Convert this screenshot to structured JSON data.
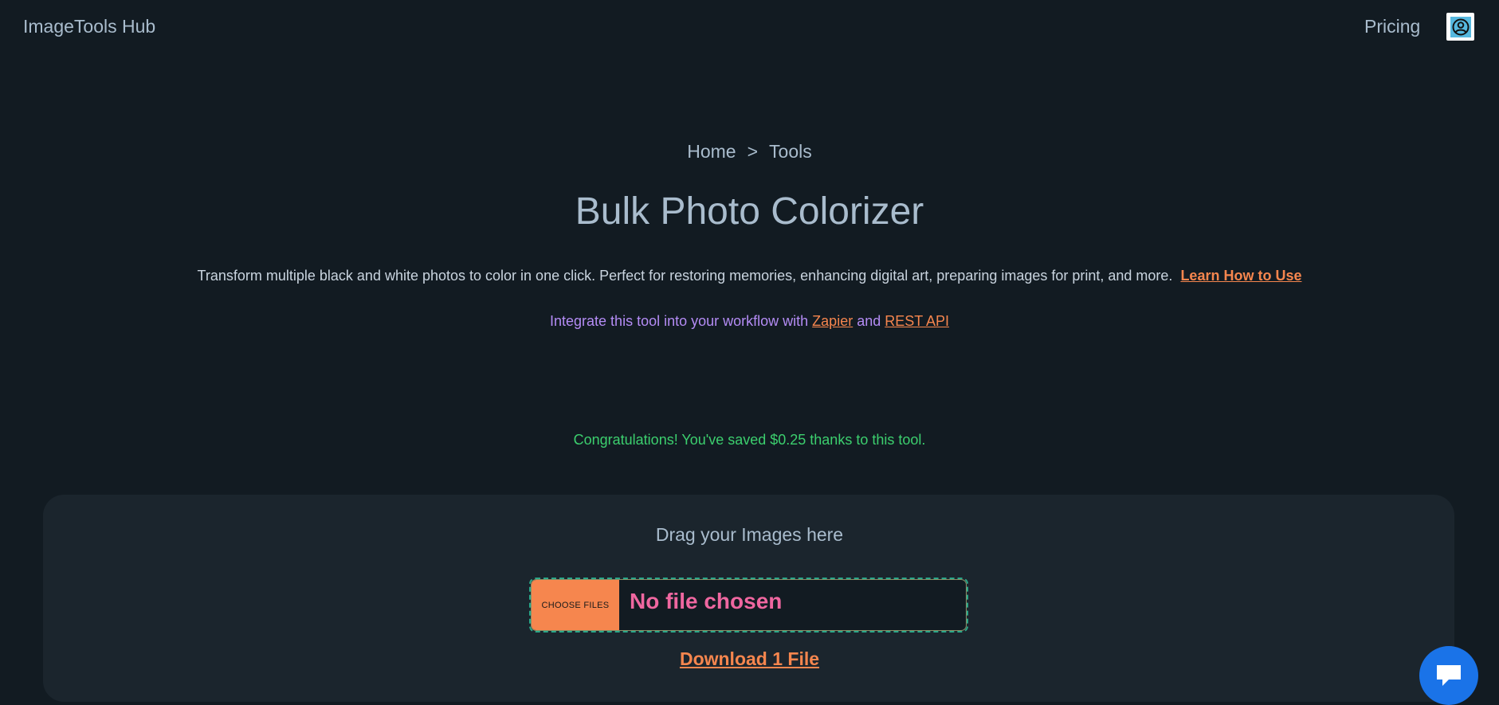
{
  "header": {
    "brand": "ImageTools Hub",
    "pricing_label": "Pricing",
    "avatar_icon": "user-circle-icon"
  },
  "breadcrumb": {
    "home": "Home",
    "separator": ">",
    "current": "Tools"
  },
  "page": {
    "title": "Bulk Photo Colorizer",
    "description": "Transform multiple black and white photos to color in one click. Perfect for restoring memories, enhancing digital art, preparing images for print, and more.",
    "learn_link": "Learn How to Use",
    "integrate_prefix": "Integrate this tool into your workflow with",
    "zapier_link": "Zapier",
    "integrate_and": "and",
    "rest_api_link": "REST API",
    "savings_message": "Congratulations! You've saved $0.25 thanks to this tool."
  },
  "uploader": {
    "drag_label": "Drag your Images here",
    "choose_button": "CHOOSE FILES",
    "file_status": "No file chosen",
    "download_link": "Download 1 File"
  },
  "chat": {
    "icon": "chat-bubble-icon"
  },
  "colors": {
    "background": "#121b22",
    "panel": "#1b252d",
    "accent_orange": "#f6864e",
    "text_muted": "#a9bccd",
    "purple_text": "#b48cf5",
    "success_green": "#3ccf6e",
    "status_pink": "#ef67a0",
    "chat_blue": "#1a73e8"
  }
}
